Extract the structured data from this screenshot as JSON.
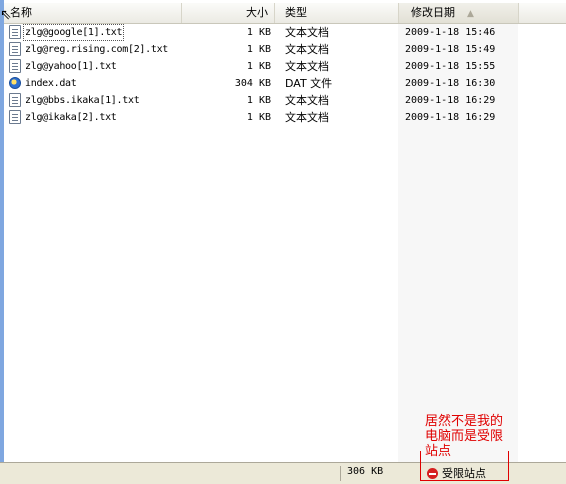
{
  "columns": {
    "name": "名称",
    "size": "大小",
    "type": "类型",
    "date": "修改日期"
  },
  "files": [
    {
      "name": "zlg@google[1].txt",
      "size": "1 KB",
      "type": "文本文档",
      "date": "2009-1-18 15:46",
      "icon": "text-file-icon"
    },
    {
      "name": "zlg@reg.rising.com[2].txt",
      "size": "1 KB",
      "type": "文本文档",
      "date": "2009-1-18 15:49",
      "icon": "text-file-icon"
    },
    {
      "name": "zlg@yahoo[1].txt",
      "size": "1 KB",
      "type": "文本文档",
      "date": "2009-1-18 15:55",
      "icon": "text-file-icon"
    },
    {
      "name": "index.dat",
      "size": "304 KB",
      "type": "DAT 文件",
      "date": "2009-1-18 16:30",
      "icon": "dat-file-icon"
    },
    {
      "name": "zlg@bbs.ikaka[1].txt",
      "size": "1 KB",
      "type": "文本文档",
      "date": "2009-1-18 16:29",
      "icon": "text-file-icon"
    },
    {
      "name": "zlg@ikaka[2].txt",
      "size": "1 KB",
      "type": "文本文档",
      "date": "2009-1-18 16:29",
      "icon": "text-file-icon"
    }
  ],
  "status": {
    "total_size": "306 KB",
    "zone": "受限站点"
  },
  "annotation": {
    "text": "居然不是我的电脑而是受限站点",
    "color": "#e00000"
  }
}
